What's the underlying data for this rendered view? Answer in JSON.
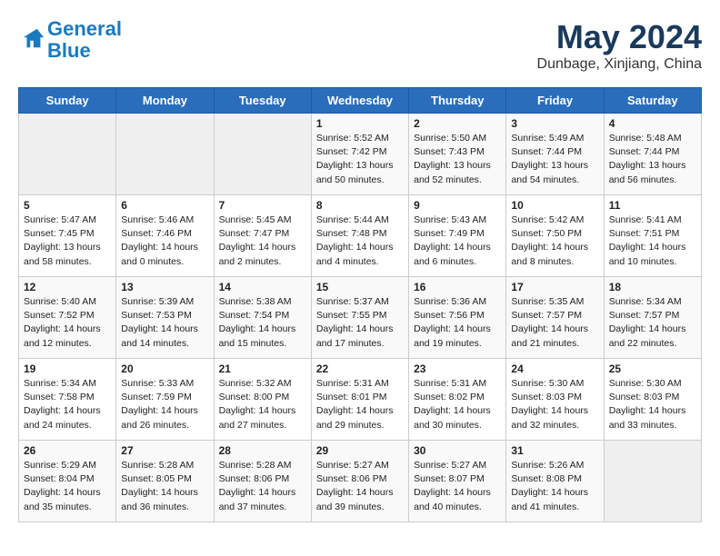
{
  "logo": {
    "line1": "General",
    "line2": "Blue"
  },
  "title": "May 2024",
  "subtitle": "Dunbage, Xinjiang, China",
  "days_of_week": [
    "Sunday",
    "Monday",
    "Tuesday",
    "Wednesday",
    "Thursday",
    "Friday",
    "Saturday"
  ],
  "weeks": [
    [
      {
        "day": "",
        "info": ""
      },
      {
        "day": "",
        "info": ""
      },
      {
        "day": "",
        "info": ""
      },
      {
        "day": "1",
        "info": "Sunrise: 5:52 AM\nSunset: 7:42 PM\nDaylight: 13 hours\nand 50 minutes."
      },
      {
        "day": "2",
        "info": "Sunrise: 5:50 AM\nSunset: 7:43 PM\nDaylight: 13 hours\nand 52 minutes."
      },
      {
        "day": "3",
        "info": "Sunrise: 5:49 AM\nSunset: 7:44 PM\nDaylight: 13 hours\nand 54 minutes."
      },
      {
        "day": "4",
        "info": "Sunrise: 5:48 AM\nSunset: 7:44 PM\nDaylight: 13 hours\nand 56 minutes."
      }
    ],
    [
      {
        "day": "5",
        "info": "Sunrise: 5:47 AM\nSunset: 7:45 PM\nDaylight: 13 hours\nand 58 minutes."
      },
      {
        "day": "6",
        "info": "Sunrise: 5:46 AM\nSunset: 7:46 PM\nDaylight: 14 hours\nand 0 minutes."
      },
      {
        "day": "7",
        "info": "Sunrise: 5:45 AM\nSunset: 7:47 PM\nDaylight: 14 hours\nand 2 minutes."
      },
      {
        "day": "8",
        "info": "Sunrise: 5:44 AM\nSunset: 7:48 PM\nDaylight: 14 hours\nand 4 minutes."
      },
      {
        "day": "9",
        "info": "Sunrise: 5:43 AM\nSunset: 7:49 PM\nDaylight: 14 hours\nand 6 minutes."
      },
      {
        "day": "10",
        "info": "Sunrise: 5:42 AM\nSunset: 7:50 PM\nDaylight: 14 hours\nand 8 minutes."
      },
      {
        "day": "11",
        "info": "Sunrise: 5:41 AM\nSunset: 7:51 PM\nDaylight: 14 hours\nand 10 minutes."
      }
    ],
    [
      {
        "day": "12",
        "info": "Sunrise: 5:40 AM\nSunset: 7:52 PM\nDaylight: 14 hours\nand 12 minutes."
      },
      {
        "day": "13",
        "info": "Sunrise: 5:39 AM\nSunset: 7:53 PM\nDaylight: 14 hours\nand 14 minutes."
      },
      {
        "day": "14",
        "info": "Sunrise: 5:38 AM\nSunset: 7:54 PM\nDaylight: 14 hours\nand 15 minutes."
      },
      {
        "day": "15",
        "info": "Sunrise: 5:37 AM\nSunset: 7:55 PM\nDaylight: 14 hours\nand 17 minutes."
      },
      {
        "day": "16",
        "info": "Sunrise: 5:36 AM\nSunset: 7:56 PM\nDaylight: 14 hours\nand 19 minutes."
      },
      {
        "day": "17",
        "info": "Sunrise: 5:35 AM\nSunset: 7:57 PM\nDaylight: 14 hours\nand 21 minutes."
      },
      {
        "day": "18",
        "info": "Sunrise: 5:34 AM\nSunset: 7:57 PM\nDaylight: 14 hours\nand 22 minutes."
      }
    ],
    [
      {
        "day": "19",
        "info": "Sunrise: 5:34 AM\nSunset: 7:58 PM\nDaylight: 14 hours\nand 24 minutes."
      },
      {
        "day": "20",
        "info": "Sunrise: 5:33 AM\nSunset: 7:59 PM\nDaylight: 14 hours\nand 26 minutes."
      },
      {
        "day": "21",
        "info": "Sunrise: 5:32 AM\nSunset: 8:00 PM\nDaylight: 14 hours\nand 27 minutes."
      },
      {
        "day": "22",
        "info": "Sunrise: 5:31 AM\nSunset: 8:01 PM\nDaylight: 14 hours\nand 29 minutes."
      },
      {
        "day": "23",
        "info": "Sunrise: 5:31 AM\nSunset: 8:02 PM\nDaylight: 14 hours\nand 30 minutes."
      },
      {
        "day": "24",
        "info": "Sunrise: 5:30 AM\nSunset: 8:03 PM\nDaylight: 14 hours\nand 32 minutes."
      },
      {
        "day": "25",
        "info": "Sunrise: 5:30 AM\nSunset: 8:03 PM\nDaylight: 14 hours\nand 33 minutes."
      }
    ],
    [
      {
        "day": "26",
        "info": "Sunrise: 5:29 AM\nSunset: 8:04 PM\nDaylight: 14 hours\nand 35 minutes."
      },
      {
        "day": "27",
        "info": "Sunrise: 5:28 AM\nSunset: 8:05 PM\nDaylight: 14 hours\nand 36 minutes."
      },
      {
        "day": "28",
        "info": "Sunrise: 5:28 AM\nSunset: 8:06 PM\nDaylight: 14 hours\nand 37 minutes."
      },
      {
        "day": "29",
        "info": "Sunrise: 5:27 AM\nSunset: 8:06 PM\nDaylight: 14 hours\nand 39 minutes."
      },
      {
        "day": "30",
        "info": "Sunrise: 5:27 AM\nSunset: 8:07 PM\nDaylight: 14 hours\nand 40 minutes."
      },
      {
        "day": "31",
        "info": "Sunrise: 5:26 AM\nSunset: 8:08 PM\nDaylight: 14 hours\nand 41 minutes."
      },
      {
        "day": "",
        "info": ""
      }
    ]
  ]
}
